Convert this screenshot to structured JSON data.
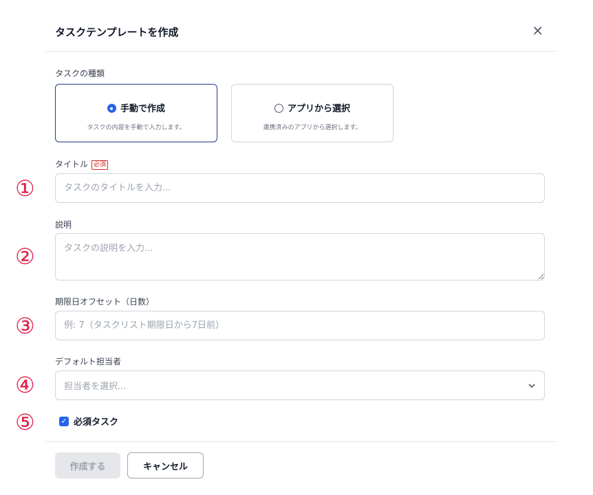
{
  "dialog": {
    "title": "タスクテンプレートを作成",
    "close_icon": "×"
  },
  "task_type": {
    "label": "タスクの種類",
    "options": [
      {
        "label": "手動で作成",
        "description": "タスクの内容を手動で入力します。",
        "selected": true
      },
      {
        "label": "アプリから選択",
        "description": "連携済みのアプリから選択します。",
        "selected": false
      }
    ]
  },
  "title_field": {
    "label": "タイトル",
    "required_badge": "必須",
    "placeholder": "タスクのタイトルを入力...",
    "marker": "①"
  },
  "description_field": {
    "label": "説明",
    "placeholder": "タスクの説明を入力...",
    "marker": "②"
  },
  "due_offset_field": {
    "label": "期限日オフセット（日数）",
    "placeholder": "例: 7（タスクリスト期限日から7日前）",
    "marker": "③"
  },
  "assignee_field": {
    "label": "デフォルト担当者",
    "placeholder": "担当者を選択...",
    "marker": "④"
  },
  "required_task": {
    "label": "必須タスク",
    "checked": true,
    "marker": "⑤"
  },
  "footer": {
    "create_label": "作成する",
    "cancel_label": "キャンセル"
  },
  "colors": {
    "accent": "#2563eb",
    "marker": "#e11d48",
    "required": "#dc2626"
  }
}
